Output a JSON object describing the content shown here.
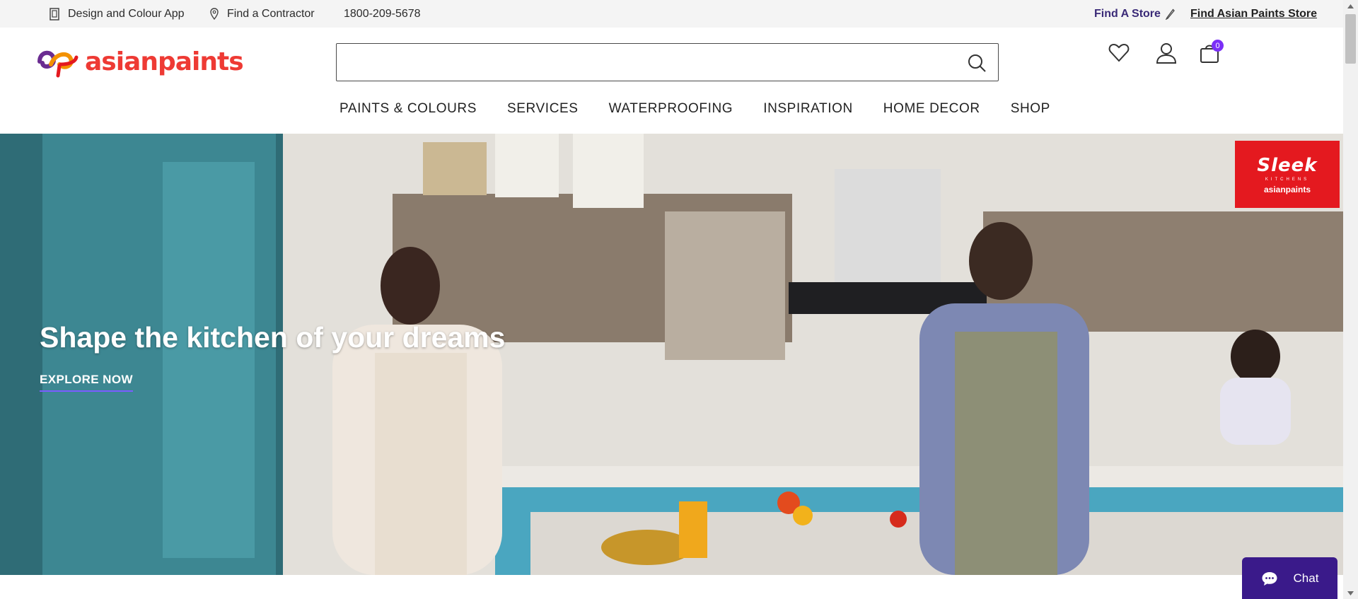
{
  "topbar": {
    "app_label": "Design and Colour App",
    "contractor_label": "Find a Contractor",
    "phone": "1800-209-5678",
    "find_store_label": "Find A Store",
    "find_ap_store_label": "Find Asian Paints Store"
  },
  "header": {
    "logo_text": "asianpaints",
    "search": {
      "value": "",
      "placeholder": ""
    },
    "cart_count": "0",
    "nav": [
      "PAINTS & COLOURS",
      "SERVICES",
      "WATERPROOFING",
      "INSPIRATION",
      "HOME DECOR",
      "SHOP"
    ]
  },
  "hero": {
    "title": "Shape the kitchen of your dreams",
    "cta": "EXPLORE NOW",
    "badge_title": "Sleek",
    "badge_sub": "KITCHENS",
    "badge_brand": "asianpaints"
  },
  "chat": {
    "label": "Chat"
  },
  "colors": {
    "brand_red": "#ee3a34",
    "accent_purple": "#7b2ff7",
    "find_store_text": "#3a2a77",
    "chat_bg": "#3a1a8a",
    "cta_underline": "#7b5cff"
  },
  "icons": [
    "app-icon",
    "location-pin-icon",
    "pencil-icon",
    "search-icon",
    "heart-icon",
    "user-icon",
    "cart-icon",
    "chat-bubble-icon"
  ]
}
